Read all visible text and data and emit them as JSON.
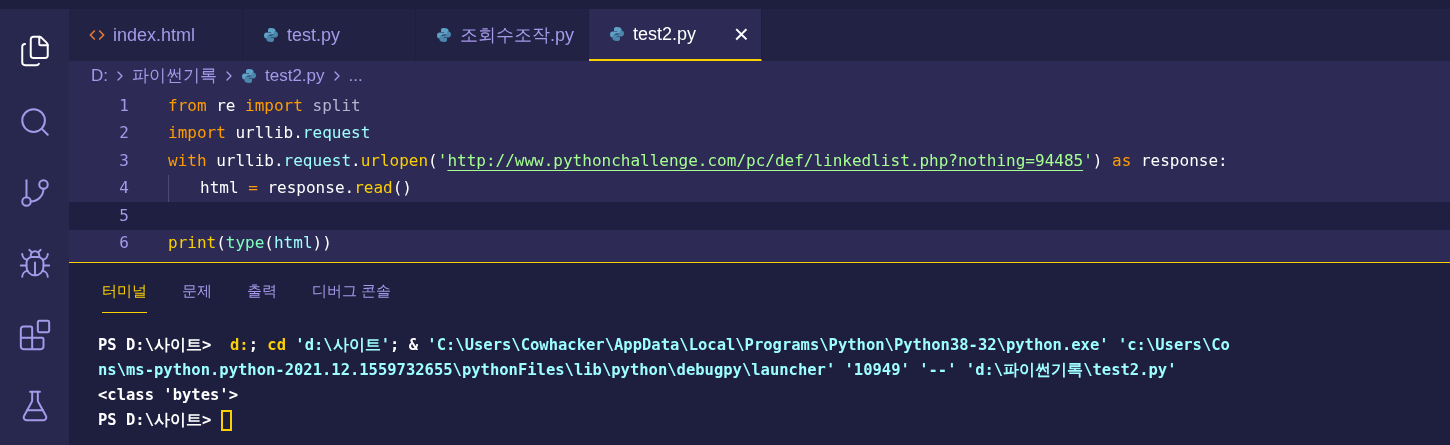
{
  "activity_bar": [
    {
      "kind": "files",
      "selected": true
    },
    {
      "kind": "search",
      "selected": false
    },
    {
      "kind": "source-control",
      "selected": false
    },
    {
      "kind": "run-debug",
      "selected": false
    },
    {
      "kind": "extensions",
      "selected": false
    },
    {
      "kind": "testing",
      "selected": false
    }
  ],
  "tabs": [
    {
      "label": "index.html",
      "kind": "html",
      "selected": false
    },
    {
      "label": "test.py",
      "kind": "python",
      "selected": false
    },
    {
      "label": "조회수조작.py",
      "kind": "python",
      "selected": false
    },
    {
      "label": "test2.py",
      "kind": "python",
      "selected": true,
      "close": "×"
    }
  ],
  "breadcrumb": [
    {
      "label": "D:"
    },
    {
      "label": "파이썬기록"
    },
    {
      "label": "test2.py",
      "kind": "python"
    },
    {
      "label": "..."
    }
  ],
  "code": [
    {
      "number": "1",
      "current": false,
      "tokens": [
        {
          "text": "from",
          "kind": "keyword"
        },
        {
          "text": " re ",
          "kind": "plain"
        },
        {
          "text": "import",
          "kind": "keyword"
        },
        {
          "text": " split",
          "kind": "muted"
        }
      ]
    },
    {
      "number": "2",
      "current": false,
      "tokens": [
        {
          "text": "import",
          "kind": "keyword"
        },
        {
          "text": " urllib.",
          "kind": "plain"
        },
        {
          "text": "request",
          "kind": "attr"
        }
      ]
    },
    {
      "number": "3",
      "current": false,
      "tokens": [
        {
          "text": "with",
          "kind": "keyword"
        },
        {
          "text": " urllib.",
          "kind": "plain"
        },
        {
          "text": "request",
          "kind": "attr"
        },
        {
          "text": ".",
          "kind": "plain"
        },
        {
          "text": "urlopen",
          "kind": "func"
        },
        {
          "text": "(",
          "kind": "plain"
        },
        {
          "text": "'",
          "kind": "string"
        },
        {
          "text": "http://www.pythonchallenge.com/pc/def/linkedlist.php?nothing=94485",
          "kind": "link"
        },
        {
          "text": "'",
          "kind": "string"
        },
        {
          "text": ") ",
          "kind": "plain"
        },
        {
          "text": "as",
          "kind": "keyword"
        },
        {
          "text": " response:",
          "kind": "plain"
        }
      ]
    },
    {
      "number": "4",
      "current": false,
      "indent": true,
      "tokens": [
        {
          "text": "html ",
          "kind": "plain"
        },
        {
          "text": "=",
          "kind": "keyword"
        },
        {
          "text": " response.",
          "kind": "plain"
        },
        {
          "text": "read",
          "kind": "func"
        },
        {
          "text": "()",
          "kind": "plain"
        }
      ]
    },
    {
      "number": "5",
      "current": true
    },
    {
      "number": "6",
      "current": false,
      "tokens": [
        {
          "text": "print",
          "kind": "func"
        },
        {
          "text": "(",
          "kind": "plain"
        },
        {
          "text": "type",
          "kind": "builtin"
        },
        {
          "text": "(",
          "kind": "plain"
        },
        {
          "text": "html",
          "kind": "attr"
        },
        {
          "text": "))",
          "kind": "plain"
        }
      ]
    }
  ],
  "panel_tabs": [
    {
      "label": "터미널",
      "selected": true
    },
    {
      "label": "문제",
      "selected": false
    },
    {
      "label": "출력",
      "selected": false
    },
    {
      "label": "디버그 콘솔",
      "selected": false
    }
  ],
  "terminal": [
    {
      "tokens": [
        {
          "text": "PS D:\\사이트>  ",
          "kind": "plain"
        },
        {
          "text": "d:",
          "kind": "command"
        },
        {
          "text": "; ",
          "kind": "plain"
        },
        {
          "text": "cd",
          "kind": "command"
        },
        {
          "text": " 'd:\\사이트'",
          "kind": "string"
        },
        {
          "text": "; & ",
          "kind": "plain"
        },
        {
          "text": "'C:\\Users\\Cowhacker\\AppData\\Local\\Programs\\Python\\Python38-32\\python.exe' 'c:\\Users\\Co",
          "kind": "string"
        }
      ]
    },
    {
      "tokens": [
        {
          "text": "ns\\ms-python.python-2021.12.1559732655\\pythonFiles\\lib\\python\\debugpy\\launcher' '10949' '--' 'd:\\파이썬기록\\test2.py'",
          "kind": "string"
        }
      ]
    },
    {
      "tokens": [
        {
          "text": "<class 'bytes'>",
          "kind": "plain"
        }
      ]
    },
    {
      "tokens": [
        {
          "text": "PS D:\\사이트> ",
          "kind": "plain"
        }
      ],
      "cursor": true
    }
  ]
}
